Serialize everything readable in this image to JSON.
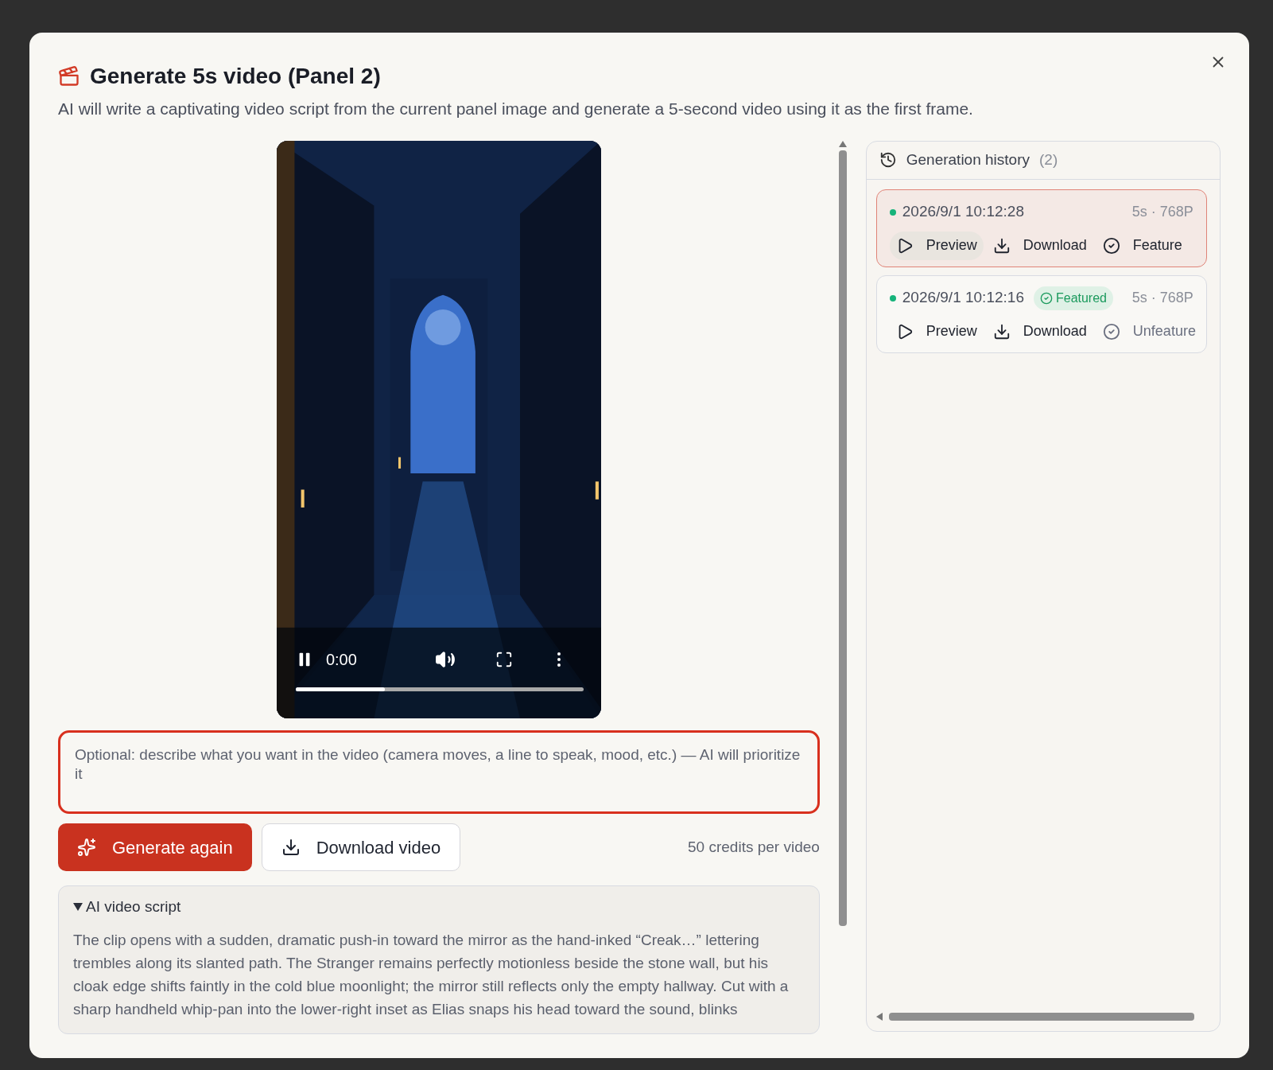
{
  "dialog": {
    "title": "Generate 5s video (Panel 2)",
    "subtitle": "AI will write a captivating video script from the current panel image and generate a 5-second video using it as the first frame."
  },
  "video": {
    "kind": "picture",
    "time": "0:00",
    "playing": true,
    "level": 0.31
  },
  "prompt": {
    "placeholder": "Optional: describe what you want in the video (camera moves, a line to speak, mood, etc.) — AI will prioritize it",
    "focused": true
  },
  "actions": [
    {
      "kind": "primary",
      "label": "Generate again"
    },
    {
      "kind": "secondary",
      "label": "Download video"
    }
  ],
  "credits": "50 credits per video",
  "script": {
    "title": "AI video script",
    "expanded": true,
    "text": "The clip opens with a sudden, dramatic push-in toward the mirror as the hand-inked “Creak…” lettering trembles along its slanted path. The Stranger remains perfectly motionless beside the stone wall, but his cloak edge shifts faintly in the cold blue moonlight; the mirror still reflects only the empty hallway. Cut with a sharp handheld whip-pan into the lower-right inset as Elias snaps his head toward the sound, blinks"
  },
  "history": {
    "title": "Generation history",
    "count": "(2)",
    "items": [
      {
        "timestamp": "2026/9/1 10:12:28",
        "meta": "5s · 768P",
        "selected": true,
        "featured": false,
        "actions": [
          "Preview",
          "Download",
          "Feature"
        ]
      },
      {
        "timestamp": "2026/9/1 10:12:16",
        "meta": "5s · 768P",
        "selected": false,
        "featured": true,
        "badge": "Featured",
        "actions": [
          "Preview",
          "Download",
          "Unfeature"
        ]
      }
    ]
  }
}
